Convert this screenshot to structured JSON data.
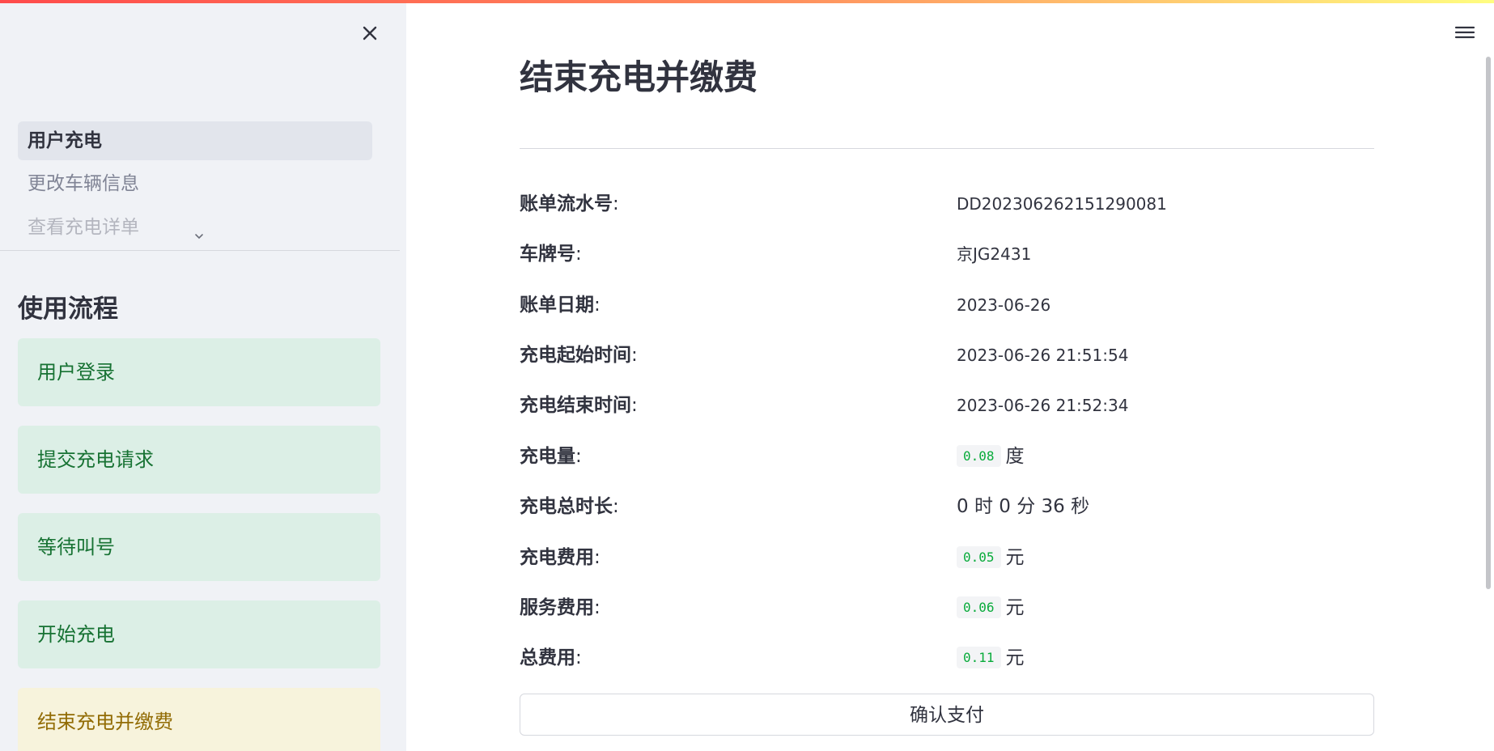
{
  "sidebar": {
    "nav_items": [
      {
        "label": "用户充电",
        "active": true
      },
      {
        "label": "更改车辆信息",
        "active": false
      },
      {
        "label": "查看充电详单",
        "active": false
      }
    ],
    "flow_title": "使用流程",
    "steps": [
      {
        "label": "用户登录",
        "state": "done"
      },
      {
        "label": "提交充电请求",
        "state": "done"
      },
      {
        "label": "等待叫号",
        "state": "done"
      },
      {
        "label": "开始充电",
        "state": "done"
      },
      {
        "label": "结束充电并缴费",
        "state": "current"
      }
    ]
  },
  "main": {
    "title": "结束充电并缴费",
    "bill": {
      "serial": {
        "label": "账单流水号",
        "value": "DD20230626215129008​1"
      },
      "plate": {
        "label": "车牌号",
        "value": "京JG2431"
      },
      "date": {
        "label": "账单日期",
        "value": "2023-06-26"
      },
      "start_time": {
        "label": "充电起始时间",
        "value": "2023-06-26 21:51:54"
      },
      "end_time": {
        "label": "充电结束时间",
        "value": "2023-06-26 21:52:34"
      },
      "amount": {
        "label": "充电量",
        "value": "0.08",
        "unit": "度"
      },
      "duration": {
        "label": "充电总时长",
        "value": "0 时 0 分 36 秒"
      },
      "charge_fee": {
        "label": "充电费用",
        "value": "0.05",
        "unit": "元"
      },
      "service_fee": {
        "label": "服务费用",
        "value": "0.06",
        "unit": "元"
      },
      "total_fee": {
        "label": "总费用",
        "value": "0.11",
        "unit": "元"
      }
    },
    "colon": ":",
    "pay_button": "确认支付"
  },
  "icons": {
    "close": "close-icon",
    "menu": "hamburger-menu-icon",
    "chevron": "chevron-down-icon"
  },
  "colors": {
    "done_bg": "#dcefe6",
    "done_text": "#177233",
    "current_bg": "#f7f3dc",
    "current_text": "#926c05",
    "code_text": "#09ab3b"
  }
}
